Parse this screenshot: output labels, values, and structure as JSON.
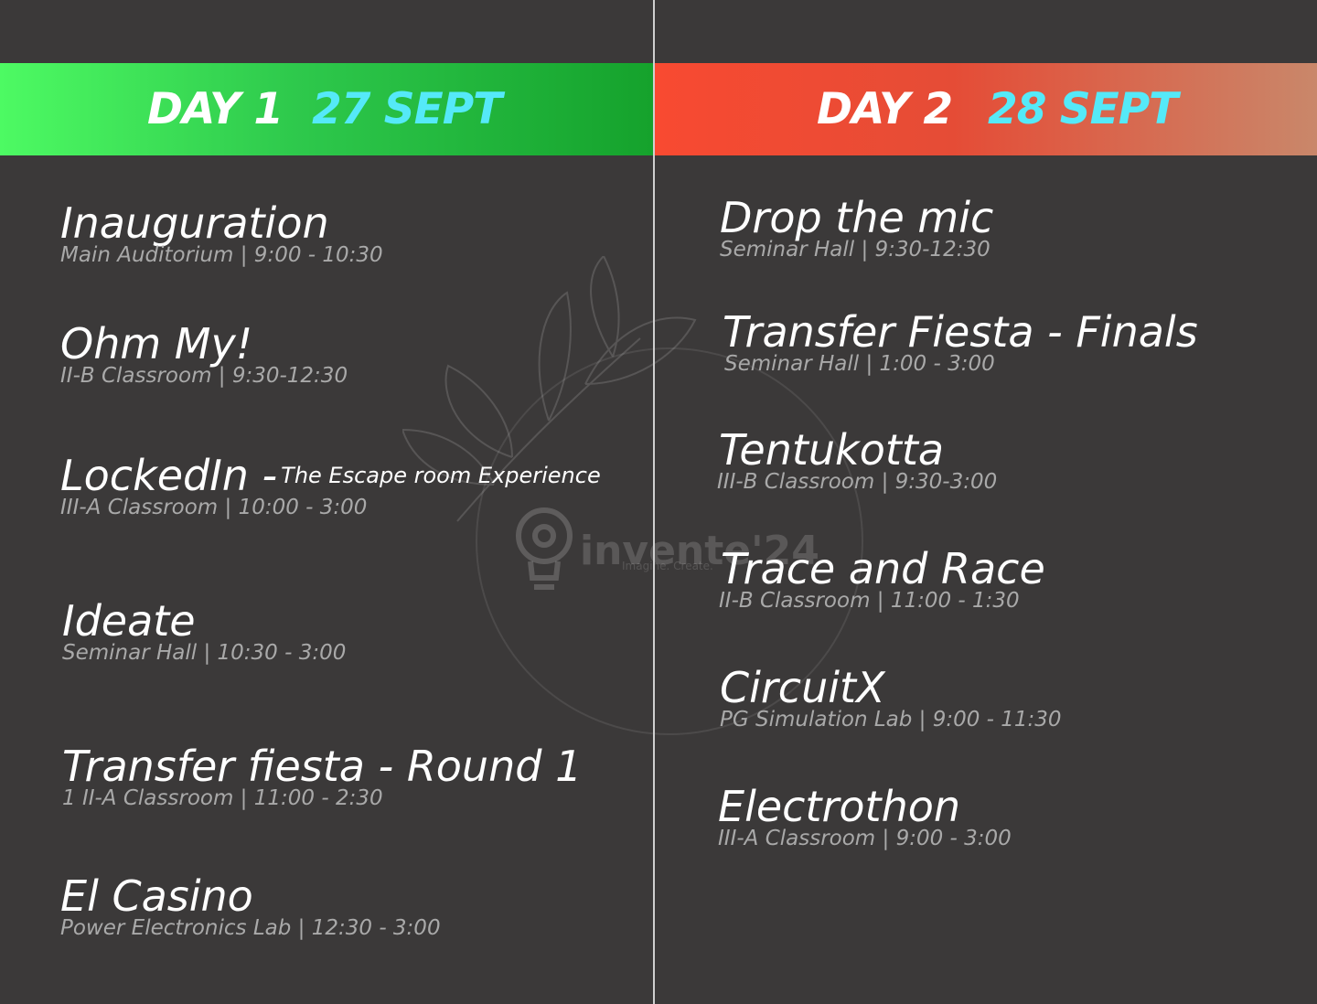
{
  "day1": {
    "label": "DAY 1",
    "date": "27 SEPT",
    "events": [
      {
        "name": "Inauguration",
        "meta": "Main Auditorium | 9:00 - 10:30"
      },
      {
        "name": "Ohm My!",
        "meta": "II-B Classroom | 9:30-12:30"
      },
      {
        "name": "LockedIn -",
        "subtitle": "The Escape room Experience",
        "meta": "III-A Classroom | 10:00 - 3:00"
      },
      {
        "name": "Ideate",
        "meta": "Seminar Hall | 10:30 - 3:00"
      },
      {
        "name": "Transfer fiesta - Round 1",
        "meta": "1 II-A Classroom | 11:00 - 2:30"
      },
      {
        "name": "El Casino",
        "meta": "Power Electronics Lab | 12:30 - 3:00"
      }
    ]
  },
  "day2": {
    "label": "DAY 2",
    "date": "28 SEPT",
    "events": [
      {
        "name": "Drop the mic",
        "meta": "Seminar Hall | 9:30-12:30"
      },
      {
        "name": "Transfer Fiesta - Finals",
        "meta": "Seminar Hall | 1:00 - 3:00"
      },
      {
        "name": "Tentukotta",
        "meta": "III-B Classroom | 9:30-3:00"
      },
      {
        "name": "Trace and Race",
        "meta": "II-B Classroom | 11:00 - 1:30"
      },
      {
        "name": "CircuitX",
        "meta": "PG Simulation Lab | 9:00 - 11:30"
      },
      {
        "name": "Electrothon",
        "meta": "III-A Classroom | 9:00 - 3:00"
      }
    ]
  },
  "watermark": {
    "logo_text": "invente'24",
    "tagline": "Imagine. Create.",
    "icon": "lightbulb-eye-icon"
  },
  "colors": {
    "background": "#3b3939",
    "day1_banner": "#2ec94c",
    "day2_banner": "#e54c36",
    "date_accent": "#55e9f8",
    "meta_text": "#a9a9a9"
  }
}
